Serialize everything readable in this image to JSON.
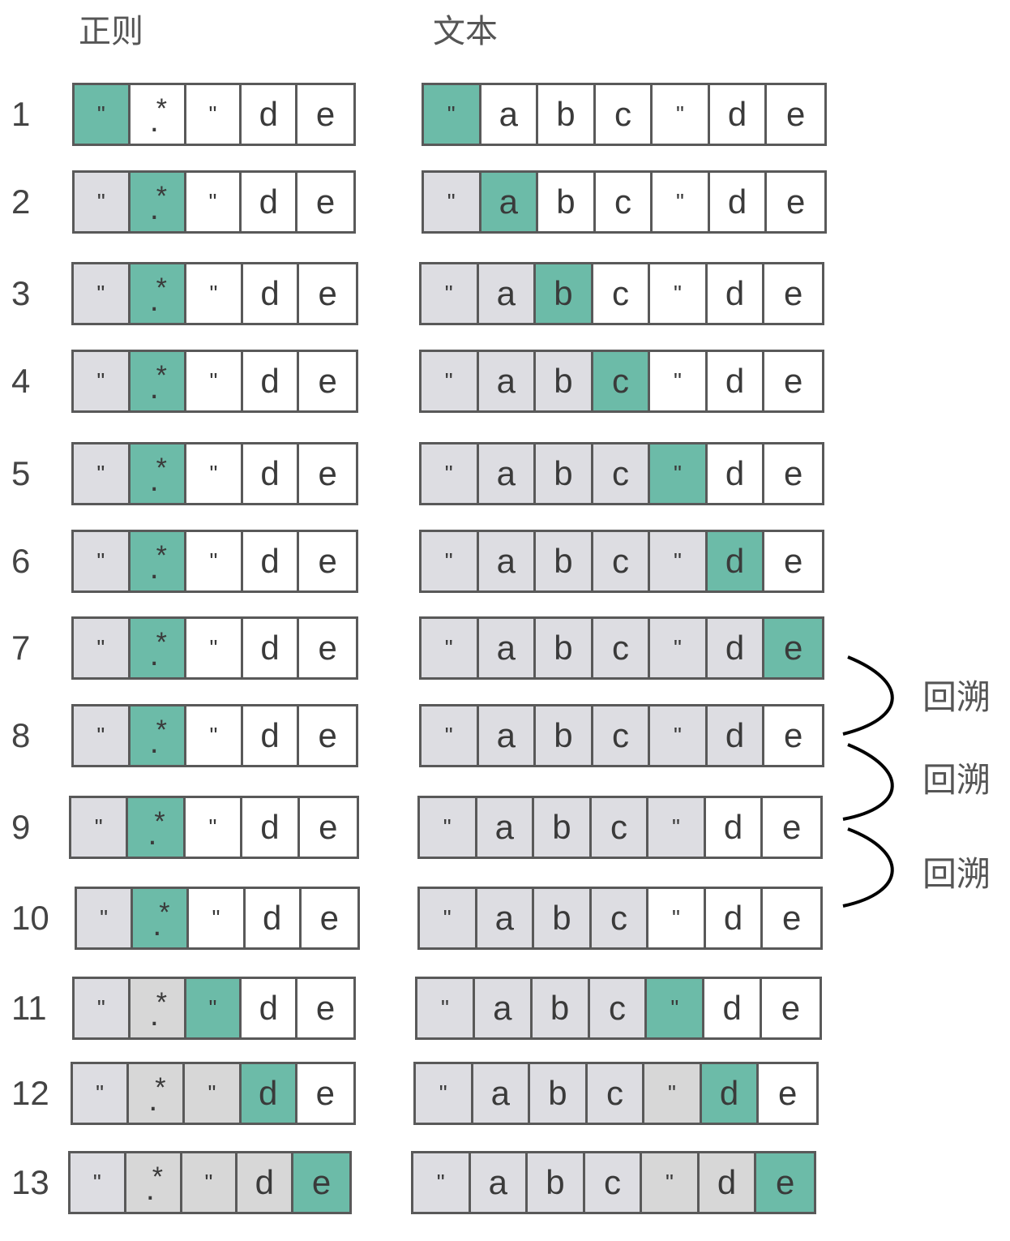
{
  "headers": {
    "regex": "正则",
    "text": "文本"
  },
  "tokens": {
    "regex": [
      "\"",
      ".*",
      "\"",
      "d",
      "e"
    ],
    "text": [
      "\"",
      "a",
      "b",
      "c",
      "\"",
      "d",
      "e"
    ]
  },
  "rows": [
    {
      "label": "1",
      "regex_states": [
        "green",
        "white",
        "white",
        "white",
        "white"
      ],
      "text_states": [
        "green",
        "white",
        "white",
        "white",
        "white",
        "white",
        "white"
      ]
    },
    {
      "label": "2",
      "regex_states": [
        "gray",
        "green",
        "white",
        "white",
        "white"
      ],
      "text_states": [
        "gray",
        "green",
        "white",
        "white",
        "white",
        "white",
        "white"
      ]
    },
    {
      "label": "3",
      "regex_states": [
        "gray",
        "green",
        "white",
        "white",
        "white"
      ],
      "text_states": [
        "gray",
        "gray",
        "green",
        "white",
        "white",
        "white",
        "white"
      ]
    },
    {
      "label": "4",
      "regex_states": [
        "gray",
        "green",
        "white",
        "white",
        "white"
      ],
      "text_states": [
        "gray",
        "gray",
        "gray",
        "green",
        "white",
        "white",
        "white"
      ]
    },
    {
      "label": "5",
      "regex_states": [
        "gray",
        "green",
        "white",
        "white",
        "white"
      ],
      "text_states": [
        "gray",
        "gray",
        "gray",
        "gray",
        "green",
        "white",
        "white"
      ]
    },
    {
      "label": "6",
      "regex_states": [
        "gray",
        "green",
        "white",
        "white",
        "white"
      ],
      "text_states": [
        "gray",
        "gray",
        "gray",
        "gray",
        "gray",
        "green",
        "white"
      ]
    },
    {
      "label": "7",
      "regex_states": [
        "gray",
        "green",
        "white",
        "white",
        "white"
      ],
      "text_states": [
        "gray",
        "gray",
        "gray",
        "gray",
        "gray",
        "gray",
        "green"
      ]
    },
    {
      "label": "8",
      "regex_states": [
        "gray",
        "green",
        "white",
        "white",
        "white"
      ],
      "text_states": [
        "gray",
        "gray",
        "gray",
        "gray",
        "gray",
        "gray",
        "white"
      ]
    },
    {
      "label": "9",
      "regex_states": [
        "gray",
        "green",
        "white",
        "white",
        "white"
      ],
      "text_states": [
        "gray",
        "gray",
        "gray",
        "gray",
        "gray",
        "white",
        "white"
      ]
    },
    {
      "label": "10",
      "regex_states": [
        "gray",
        "green",
        "white",
        "white",
        "white"
      ],
      "text_states": [
        "gray",
        "gray",
        "gray",
        "gray",
        "white",
        "white",
        "white"
      ]
    },
    {
      "label": "11",
      "regex_states": [
        "gray",
        "lgray",
        "green",
        "white",
        "white"
      ],
      "text_states": [
        "gray",
        "gray",
        "gray",
        "gray",
        "green",
        "white",
        "white"
      ]
    },
    {
      "label": "12",
      "regex_states": [
        "gray",
        "lgray",
        "lgray",
        "green",
        "white"
      ],
      "text_states": [
        "gray",
        "gray",
        "gray",
        "gray",
        "lgray",
        "green",
        "white"
      ]
    },
    {
      "label": "13",
      "regex_states": [
        "gray",
        "lgray",
        "lgray",
        "lgray",
        "green"
      ],
      "text_states": [
        "gray",
        "gray",
        "gray",
        "gray",
        "lgray",
        "lgray",
        "green"
      ]
    }
  ],
  "backtrack_labels": [
    "回溯",
    "回溯",
    "回溯"
  ],
  "colors": {
    "match": "#6cbba8",
    "consumed": "#dddde2",
    "passed": "#d7d7d7",
    "pending": "#ffffff",
    "border": "#595959"
  }
}
